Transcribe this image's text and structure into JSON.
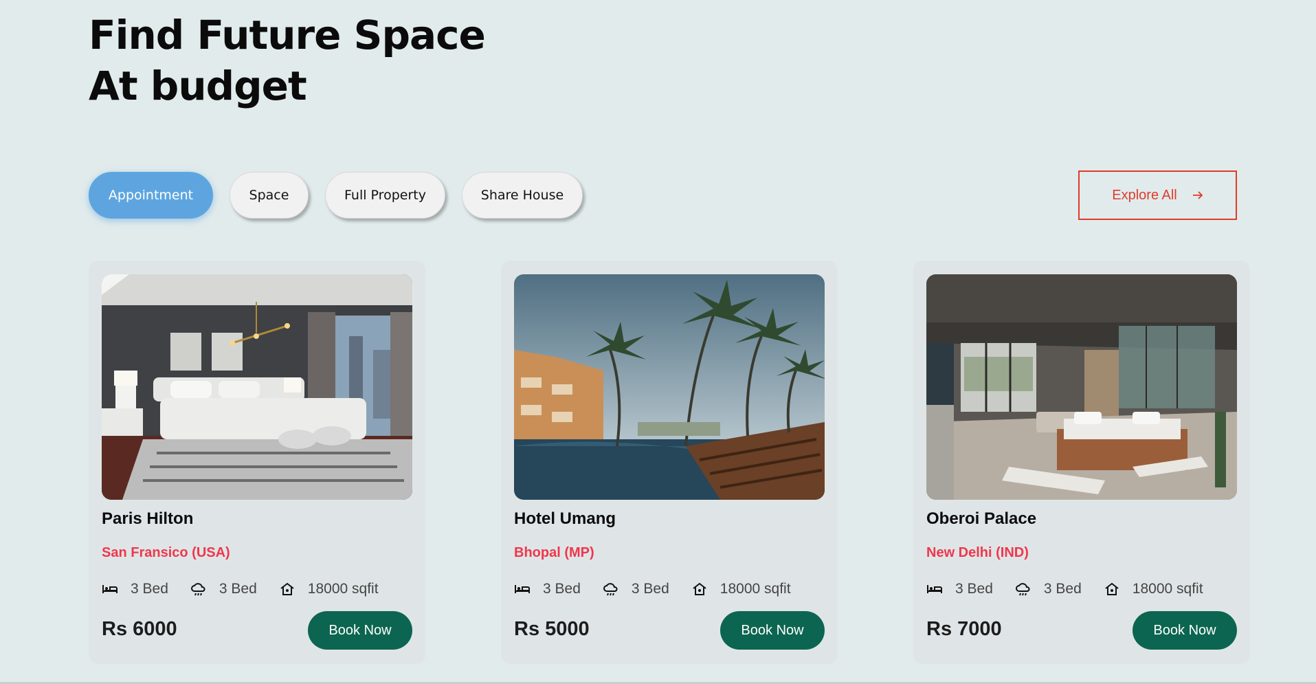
{
  "header": {
    "title_line1": "Find Future Space",
    "title_line2": "At budget"
  },
  "filters": [
    {
      "label": "Appointment",
      "active": true
    },
    {
      "label": "Space",
      "active": false
    },
    {
      "label": "Full Property",
      "active": false
    },
    {
      "label": "Share House",
      "active": false
    }
  ],
  "explore": {
    "label": "Explore All",
    "icon": "arrow-right-icon"
  },
  "listings": [
    {
      "name": "Paris Hilton",
      "location": "San Fransico (USA)",
      "beds": "3 Bed",
      "baths": "3 Bed",
      "area": "18000 sqfit",
      "price": "Rs 6000",
      "cta": "Book Now"
    },
    {
      "name": "Hotel Umang",
      "location": "Bhopal (MP)",
      "beds": "3 Bed",
      "baths": "3 Bed",
      "area": "18000 sqfit",
      "price": "Rs 5000",
      "cta": "Book Now"
    },
    {
      "name": "Oberoi Palace",
      "location": "New Delhi (IND)",
      "beds": "3 Bed",
      "baths": "3 Bed",
      "area": "18000 sqfit",
      "price": "Rs 7000",
      "cta": "Book Now"
    }
  ],
  "colors": {
    "background": "#e1ebec",
    "accent_blue": "#5ea5e0",
    "explore_red": "#e03b2a",
    "location_red": "#f0364d",
    "book_green": "#0c6550"
  }
}
